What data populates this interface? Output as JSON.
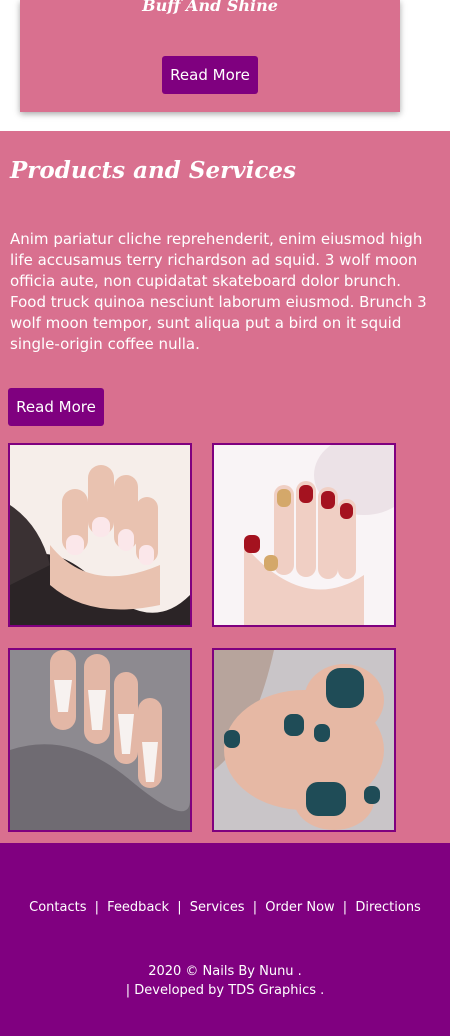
{
  "top_card": {
    "title": "Buff And Shine",
    "button_label": "Read More"
  },
  "products": {
    "heading": "Products and Services",
    "body": "Anim pariatur cliche reprehenderit, enim eiusmod high life accusamus terry richardson ad squid. 3 wolf moon officia aute, non cupidatat skateboard dolor brunch. Food truck quinoa nesciunt laborum eiusmod. Brunch 3 wolf moon tempor, sunt aliqua put a bird on it squid single-origin coffee nulla.",
    "button_label": "Read More",
    "gallery": [
      "nails-photo",
      "nails-photo",
      "nails-photo",
      "nails-photo"
    ]
  },
  "footer": {
    "links": [
      "Contacts",
      "Feedback",
      "Services",
      "Order Now",
      "Directions"
    ],
    "separator": "|",
    "copyright": "2020 ©  Nails By Nunu .",
    "developed": "| Developed by  TDS Graphics ."
  },
  "colors": {
    "accent": "#800080",
    "section_bg": "#d9708f"
  }
}
